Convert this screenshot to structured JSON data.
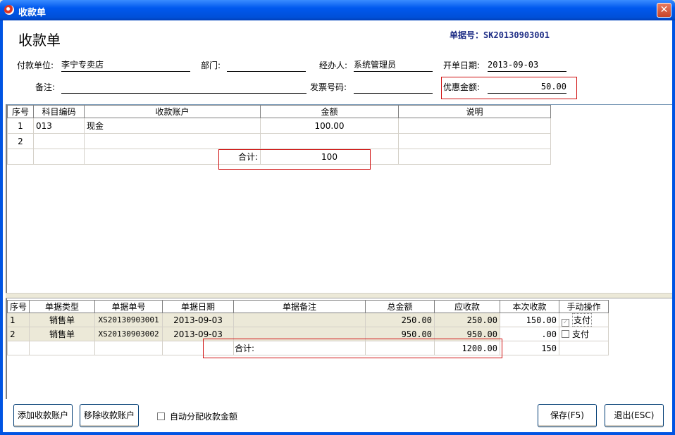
{
  "window": {
    "title": "收款单",
    "close_glyph": "✕"
  },
  "form": {
    "title": "收款单",
    "doc_no_label": "单据号：",
    "doc_no": "SK20130903001",
    "payer_label": "付款单位:",
    "payer": "李宁专卖店",
    "dept_label": "部门:",
    "dept": "",
    "handler_label": "经办人:",
    "handler": "系统管理员",
    "date_label": "开单日期:",
    "date": "2013-09-03",
    "remark_label": "备注:",
    "remark": "",
    "invoice_label": "发票号码:",
    "invoice": "",
    "discount_label": "优惠金额:",
    "discount": "50.00"
  },
  "accounts_table": {
    "headers": [
      "序号",
      "科目编码",
      "收款账户",
      "金额",
      "说明"
    ],
    "rows": [
      {
        "no": "1",
        "code": "013",
        "account": "现金",
        "amount": "100.00",
        "note": ""
      },
      {
        "no": "2",
        "code": "",
        "account": "",
        "amount": "",
        "note": ""
      }
    ],
    "total_label": "合计:",
    "total": "100"
  },
  "bills_table": {
    "headers": [
      "序号",
      "单据类型",
      "单据单号",
      "单据日期",
      "单据备注",
      "总金额",
      "应收款",
      "本次收款",
      "手动操作"
    ],
    "rows": [
      {
        "no": "1",
        "type": "销售单",
        "bill_no": "XS20130903001",
        "date": "2013-09-03",
        "remark": "",
        "total": "250.00",
        "receivable": "250.00",
        "this_time": "150.00",
        "pay_checked": true,
        "pay_label": "支付"
      },
      {
        "no": "2",
        "type": "销售单",
        "bill_no": "XS20130903002",
        "date": "2013-09-03",
        "remark": "",
        "total": "950.00",
        "receivable": "950.00",
        "this_time": ".00",
        "pay_checked": false,
        "pay_label": "支付"
      }
    ],
    "total_label": "合计:",
    "total_receivable": "1200.00",
    "total_this_time": "150"
  },
  "footer": {
    "add_account": "添加收款账户",
    "remove_account": "移除收款账户",
    "auto_allocate": "自动分配收款金额",
    "save": "保存(F5)",
    "exit": "退出(ESC)"
  },
  "colors": {
    "title_bar": "#0058EE",
    "highlight_box": "#D01010",
    "doc_no": "#1F2E86"
  }
}
